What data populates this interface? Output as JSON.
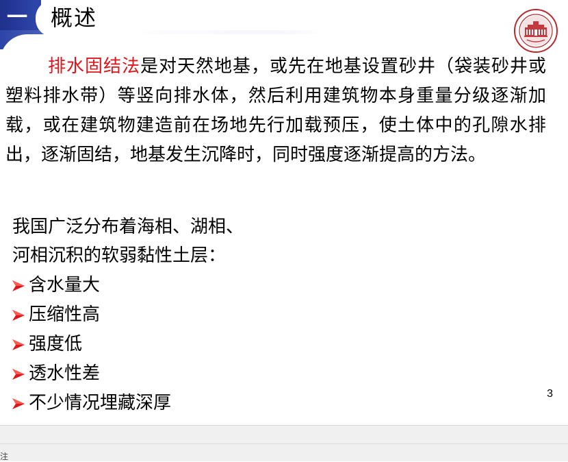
{
  "slide": {
    "section_number": "一",
    "title": "概述",
    "paragraph_highlight": "排水固结法",
    "paragraph_rest": "是对天然地基，或先在地基设置砂井（袋装砂井或塑料排水带）等竖向排水体，然后利用建筑物本身重量分级逐渐加载，或在建筑物建造前在场地先行加载预压，使土体中的孔隙水排出，逐渐固结，地基发生沉降时，同时强度逐渐提高的方法。",
    "intro_line_1": "我国广泛分布着海相、湖相、",
    "intro_line_2": "河相沉积的软弱黏性土层：",
    "bullets": [
      {
        "label": "含水量大"
      },
      {
        "label": "压缩性高"
      },
      {
        "label": "强度低"
      },
      {
        "label": "透水性差"
      },
      {
        "label": "不少情况埋藏深厚"
      }
    ],
    "page_number": "3",
    "bullet_icon": "red-arrow-icon",
    "logo_icon": "university-seal-icon"
  },
  "statusbar": {
    "text": "注"
  },
  "colors": {
    "accent_blue": "#2d44a8",
    "highlight_red": "#e0151b"
  }
}
